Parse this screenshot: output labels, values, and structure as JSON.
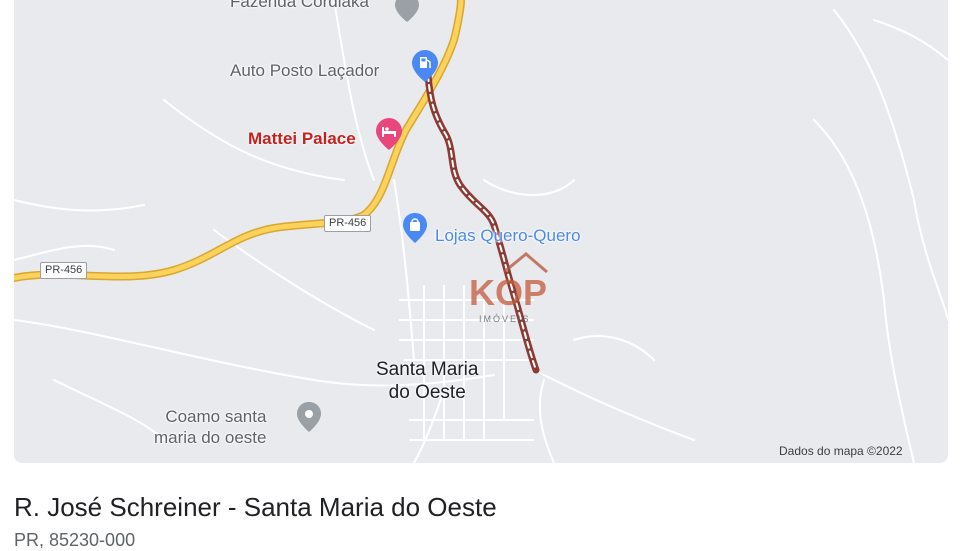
{
  "map": {
    "places": {
      "fazenda": "Fazenda Cordiaka",
      "posto": "Auto Posto Laçador",
      "hotel": "Mattei Palace",
      "lojas": "Lojas Quero-Quero",
      "coamo_line1": "Coamo santa",
      "coamo_line2": "maria do oeste",
      "town_line1": "Santa Maria",
      "town_line2": "do Oeste"
    },
    "road_shields": [
      "PR-456",
      "PR-456"
    ],
    "attribution": "Dados do mapa ©2022",
    "watermark": {
      "letters": "KOP",
      "sub": "IMÓVEIS"
    },
    "icons": [
      "place-pin-icon",
      "fuel-station-icon",
      "hotel-bed-icon",
      "shopping-bag-icon"
    ],
    "colors": {
      "background": "#e8eaed",
      "highway": "#f6c544",
      "route": "#a8453e",
      "hotel": "#e8467c",
      "poi": "#4a89f3",
      "generic_pin": "#9aa0a6"
    }
  },
  "listing": {
    "address": "R. José Schreiner - Santa Maria do Oeste",
    "postal": "PR, 85230-000"
  }
}
